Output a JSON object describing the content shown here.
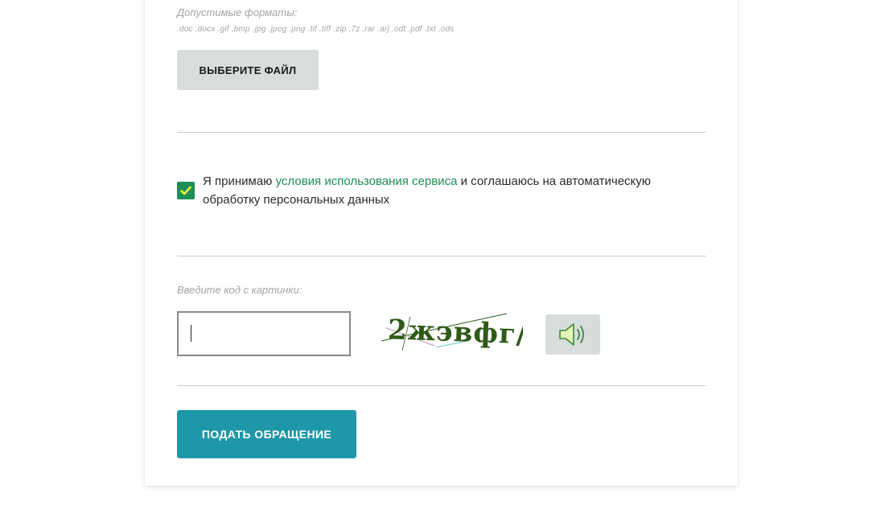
{
  "upload": {
    "formats_label": "Допустимые форматы:",
    "formats_list": ".doc .docx .gif .bmp .jpg .jpeg .png .tif .tiff .zip .7z .rar .arj .odt .pdf .txt .ods",
    "choose_file_label": "ВЫБЕРИТЕ ФАЙЛ"
  },
  "consent": {
    "checked": true,
    "text_before": "Я принимаю ",
    "link_text": "условия использования сервиса",
    "text_after": " и соглашаюсь на автоматическую обработку персональных данных"
  },
  "captcha": {
    "label": "Введите код с картинки:",
    "input_value": "",
    "image_text": "2жэвфг/",
    "audio_icon": "speaker-icon"
  },
  "submit": {
    "label": "ПОДАТЬ ОБРАЩЕНИЕ"
  },
  "colors": {
    "accent_green": "#1e8e55",
    "submit_teal": "#1e97a8",
    "button_gray": "#d9dcdd",
    "muted_text": "#a3a3a3",
    "captcha_text": "#2f5a17"
  }
}
